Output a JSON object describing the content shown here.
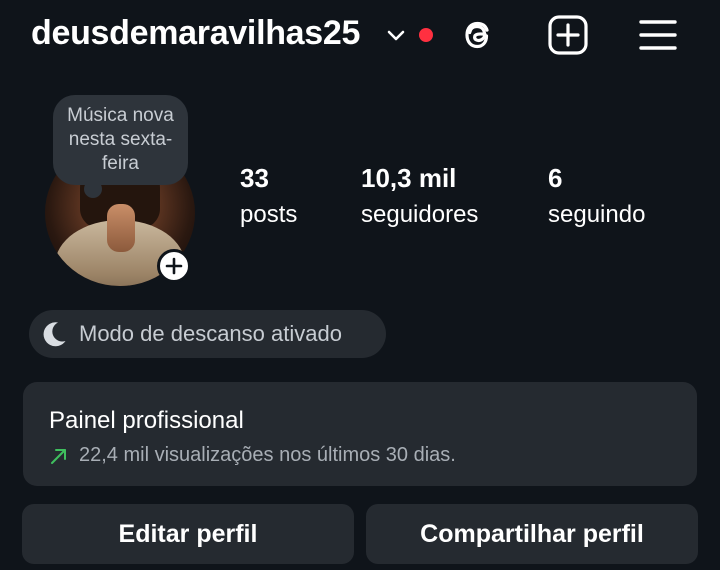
{
  "header": {
    "username": "deusdemaravilhas25",
    "icons": [
      "chevron-down-icon",
      "live-dot",
      "threads-icon",
      "add-post-icon",
      "menu-icon"
    ],
    "live_dot_color": "#ff3040"
  },
  "profile": {
    "note_text": "Música nova nesta sexta-feira",
    "stats": [
      {
        "value": "33",
        "label": "posts"
      },
      {
        "value": "10,3 mil",
        "label": "seguidores"
      },
      {
        "value": "6",
        "label": "seguindo"
      }
    ]
  },
  "rest_mode": {
    "label": "Modo de descanso ativado",
    "icon": "moon-icon"
  },
  "dashboard": {
    "title": "Painel profissional",
    "subtitle": "22,4 mil visualizações nos últimos 30 dias.",
    "trend_icon": "arrow-up-right-icon",
    "trend_color": "#3fbf5e"
  },
  "actions": {
    "edit_label": "Editar perfil",
    "share_label": "Compartilhar perfil"
  },
  "colors": {
    "background": "#0f141a",
    "card": "#252a30"
  }
}
